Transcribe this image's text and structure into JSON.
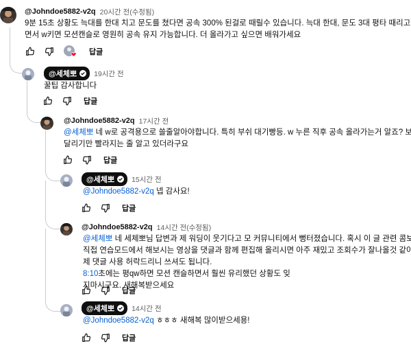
{
  "comments": [
    {
      "author": "@Johndoe5882-v2q",
      "time": "20시간 전(수정됨)",
      "lines": [
        "9분 15초 상황도 늑대를 한대 치고 문도를 쳤다면 공속 300% 된걸로 때릴수 있습니다. 늑대 한대, 문도 3대 평타 때리고 q누르",
        "면서 w키면 모션캔슬로 영원히 공속 유지 가능합니다. 더 올라가고 싶으면 배워가세요"
      ],
      "reply": "답글"
    },
    {
      "author": "@세체뽀",
      "time": "19시간 전",
      "lines": [
        "꿀팁 감사합니다"
      ],
      "reply": "답글"
    },
    {
      "author": "@Johndoe5882-v2q",
      "time": "17시간 전",
      "mention": "@세체뽀",
      "line1_rest": " 네 w로 공격용으로 쓸줄알아야합니다. 특히 부쉬 대기빵등. w 누른 직후 공속 올라가는거 알죠? 보통",
      "line2": "달리기만 빨라지는 줄 알고 있더라구요",
      "reply": "답글"
    },
    {
      "author": "@세체뽀",
      "time": "15시간 전",
      "mention": "@Johndoe5882-v2q",
      "line1_rest": " 넵 감사요!",
      "reply": "답글"
    },
    {
      "author": "@Johndoe5882-v2q",
      "time": "14시간 전(수정됨)",
      "mention": "@세체뽀",
      "line1_rest": " 네 세체뽀님 답변과 제 워딩이 웃기다고 모 커뮤니티에서 뻥터졌습니다. 혹시 이 글 관련  콤보를",
      "line2": "직접 연습모드에서 해보시는 영상을 댓글과 함께 편집해 올리시면 아주 재밌고 조회수가 잘나올것 같아요.",
      "line3": "제 댓글 사용 허락드리니 쓰셔도 됩니다.",
      "timestamp": "8:10",
      "line4_rest": "초에는 평qw하면 모션 캔슬하면서 훨씬 유리했던 상황도 잊",
      "line5": "지마시구요. 새해복받으세요",
      "reply": "답글"
    },
    {
      "author": "@세체뽀",
      "time": "14시간 전",
      "mention": "@Johndoe5882-v2q",
      "line1_rest": " ㅎㅎㅎ 새해복 많이받으세용!",
      "reply": "답글"
    }
  ],
  "colors": {
    "link": "#065fd4",
    "secondary": "#606060",
    "badge": "#0f0f0f"
  },
  "icons": [
    "thumb-up-icon",
    "thumb-down-icon",
    "creator-heart-icon",
    "verified-check-icon"
  ]
}
